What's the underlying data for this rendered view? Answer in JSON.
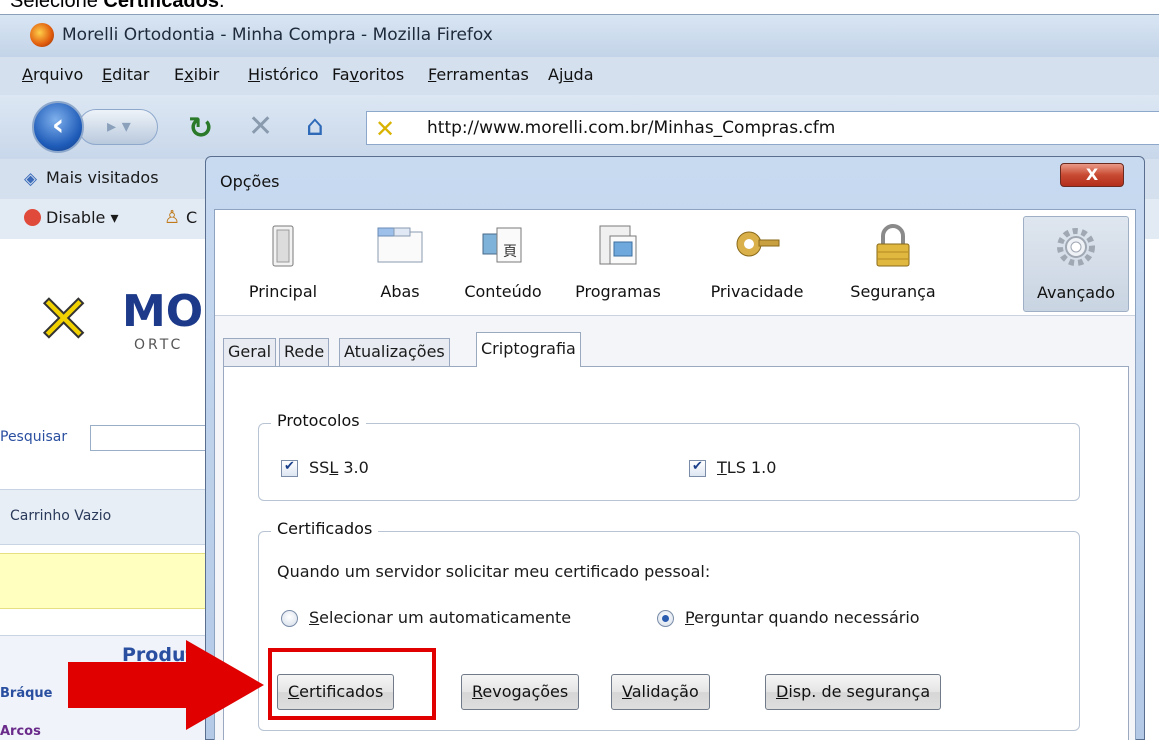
{
  "caption": {
    "prefix": "Selecione ",
    "bold": "Certificados",
    "suffix": "."
  },
  "browser": {
    "title": "Morelli Ortodontia - Minha Compra - Mozilla Firefox",
    "menu": [
      {
        "label": "Arquivo",
        "key": "A",
        "rest": "rquivo"
      },
      {
        "label": "Editar",
        "key": "E",
        "rest": "ditar"
      },
      {
        "label": "Exibir",
        "pre": "E",
        "key": "x",
        "rest": "ibir"
      },
      {
        "label": "Histórico",
        "key": "H",
        "rest": "istórico"
      },
      {
        "label": "Favoritos",
        "pre": "Fa",
        "key": "v",
        "rest": "oritos"
      },
      {
        "label": "Ferramentas",
        "key": "F",
        "rest": "erramentas"
      },
      {
        "label": "Ajuda",
        "pre": "Aj",
        "key": "u",
        "rest": "da"
      }
    ],
    "url": "http://www.morelli.com.br/Minhas_Compras.cfm",
    "bookmarks_label": "Mais visitados",
    "toolbar2_disable": "Disable ▾",
    "toolbar2_c": "C"
  },
  "page": {
    "logo_text": "MO",
    "logo_sub": "ORTC",
    "search_label": "Pesquisar",
    "cart_label": "Carrinho Vazio",
    "produtos_title": "Produt",
    "link_braquetes": "Bráque",
    "link_arcos": "Arcos"
  },
  "dialog": {
    "title": "Opções",
    "close_label": "X",
    "panes": [
      {
        "label": "Principal",
        "icon": "switch-icon"
      },
      {
        "label": "Abas",
        "icon": "tabs-icon"
      },
      {
        "label": "Conteúdo",
        "icon": "content-icon"
      },
      {
        "label": "Programas",
        "icon": "programs-icon"
      },
      {
        "label": "Privacidade",
        "icon": "key-icon"
      },
      {
        "label": "Segurança",
        "icon": "padlock-icon"
      },
      {
        "label": "Avançado",
        "icon": "gear-icon",
        "active": true
      }
    ],
    "subtabs": [
      "Geral",
      "Rede",
      "Atualizações",
      "Criptografia"
    ],
    "active_subtab": "Criptografia",
    "protocols": {
      "legend": "Protocolos",
      "ssl": {
        "pre": "SS",
        "key": "L",
        "rest": " 3.0",
        "checked": true
      },
      "tls": {
        "pre": "",
        "key": "T",
        "rest": "LS 1.0",
        "checked": true
      }
    },
    "certificates": {
      "legend": "Certificados",
      "prompt": "Quando um servidor solicitar meu certificado pessoal:",
      "option_auto": {
        "key": "S",
        "rest": "elecionar um automaticamente",
        "checked": false
      },
      "option_ask": {
        "key": "P",
        "rest": "erguntar quando necessário",
        "checked": true
      },
      "buttons": [
        {
          "key": "C",
          "rest": "ertificados"
        },
        {
          "key": "R",
          "rest": "evogações"
        },
        {
          "key": "V",
          "rest": "alidação"
        },
        {
          "key": "D",
          "rest": "isp. de segurança"
        }
      ]
    }
  },
  "colors": {
    "highlight": "#e00000",
    "arrow": "#e00000"
  }
}
